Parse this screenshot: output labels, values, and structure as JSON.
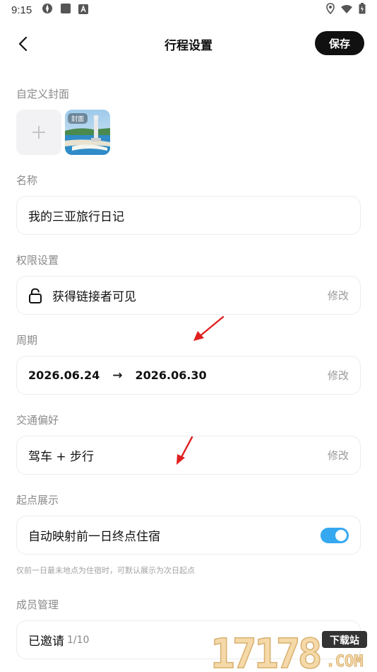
{
  "status": {
    "time": "9:15"
  },
  "header": {
    "title": "行程设置",
    "save_label": "保存"
  },
  "cover": {
    "label": "自定义封面",
    "thumb_tag": "封面"
  },
  "name": {
    "label": "名称",
    "value": "我的三亚旅行日记"
  },
  "permission": {
    "label": "权限设置",
    "value": "获得链接者可见",
    "action": "修改"
  },
  "period": {
    "label": "周期",
    "start": "2026.06.24",
    "arrow": "→",
    "end": "2026.06.30",
    "action": "修改"
  },
  "transport": {
    "label": "交通偏好",
    "value": "驾车 + 步行",
    "action": "修改"
  },
  "start_point": {
    "label": "起点展示",
    "value": "自动映射前一日终点住宿",
    "enabled": true,
    "hint": "仅前一日最末地点为住宿时，可默认展示为次日起点"
  },
  "members": {
    "label": "成员管理",
    "value": "已邀请",
    "count": "1/10"
  },
  "watermark": {
    "number": "17178",
    "tag": "下载站",
    "suffix": ".COM"
  },
  "colors": {
    "accent": "#35a8f0",
    "primary": "#111111",
    "annotation": "#e02020"
  }
}
